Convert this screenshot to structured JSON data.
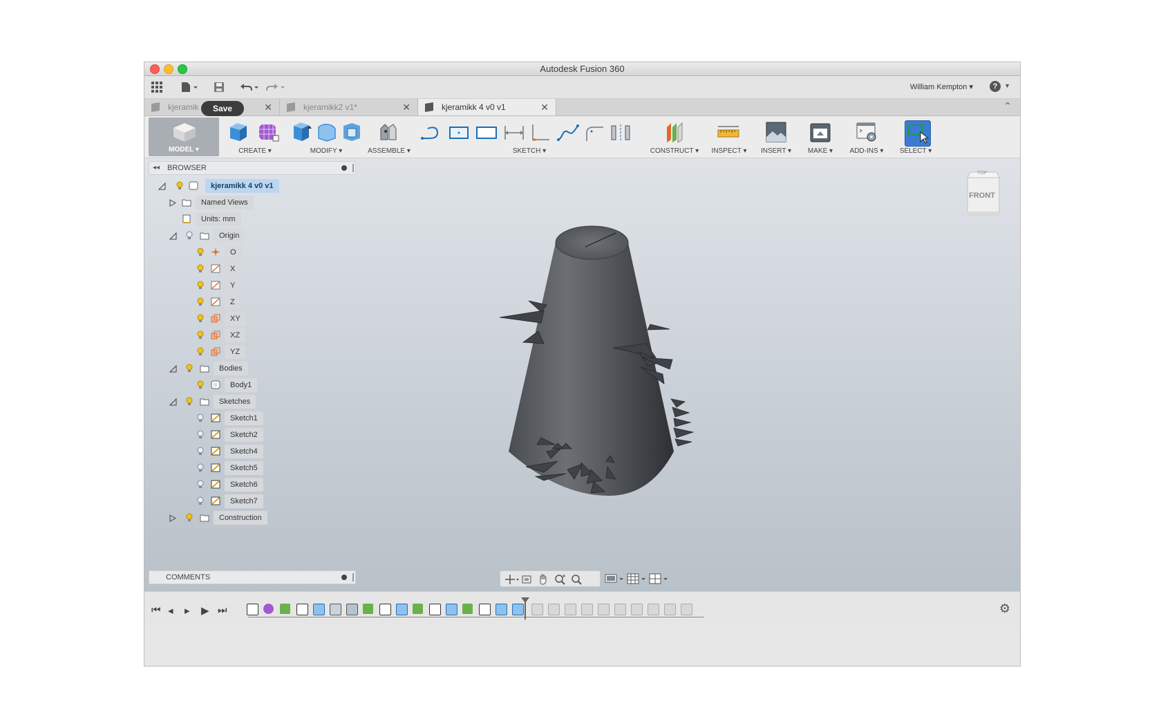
{
  "window": {
    "title": "Autodesk Fusion 360"
  },
  "quick_access": {
    "user_name": "William Kempton ▾",
    "help_label": "?"
  },
  "tabs": [
    {
      "label": "kjeramik"
    },
    {
      "label": "kjeramikk2 v1*"
    },
    {
      "label": "kjeramikk 4 v0 v1"
    }
  ],
  "tooltip": {
    "save": "Save"
  },
  "toolbar": {
    "model_label": "MODEL ▾",
    "groups": [
      "CREATE ▾",
      "MODIFY ▾",
      "ASSEMBLE ▾",
      "SKETCH ▾",
      "CONSTRUCT ▾",
      "INSPECT ▾",
      "INSERT ▾",
      "MAKE ▾",
      "ADD-INS ▾",
      "SELECT ▾"
    ]
  },
  "browser": {
    "header": "BROWSER",
    "root": "kjeramikk 4 v0 v1",
    "named_views": "Named Views",
    "units": "Units: mm",
    "origin": {
      "label": "Origin",
      "items": [
        "O",
        "X",
        "Y",
        "Z",
        "XY",
        "XZ",
        "YZ"
      ]
    },
    "bodies": {
      "label": "Bodies",
      "items": [
        "Body1"
      ]
    },
    "sketches": {
      "label": "Sketches",
      "items": [
        "Sketch1",
        "Sketch2",
        "Sketch4",
        "Sketch5",
        "Sketch6",
        "Sketch7"
      ]
    },
    "construction": "Construction"
  },
  "viewcube": {
    "top": "TOP",
    "front": "FRONT"
  },
  "comments": {
    "label": "COMMENTS"
  },
  "colors": {
    "select_accent": "#3c7bd4",
    "bulb": "#f2c31b",
    "origin_icon": "#e06a2b"
  }
}
